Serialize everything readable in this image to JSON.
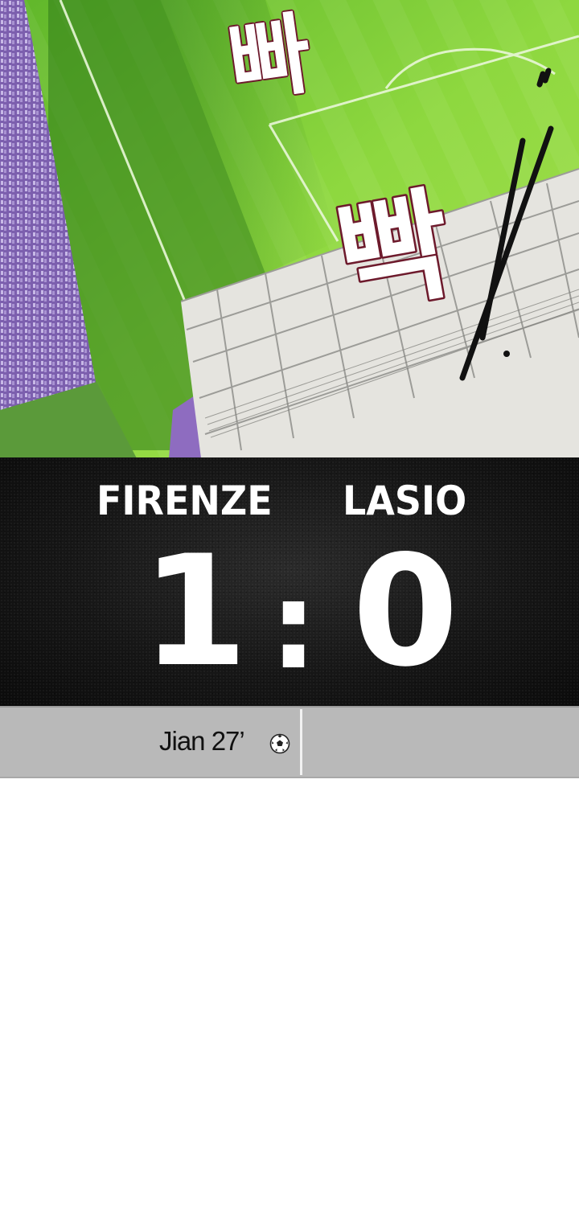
{
  "sound_effects": [
    "빠",
    "빡",
    "빠",
    "빡!"
  ],
  "scoreboard": {
    "home_team": "FIRENZE",
    "away_team": "LASIO",
    "home_score": "1",
    "separator": ":",
    "away_score": "0"
  },
  "scorers": {
    "home": "Jian 27’",
    "away": ""
  },
  "icons": {
    "goal": "soccer-ball-icon"
  },
  "colors": {
    "pitch": "#7fcf3a",
    "scoreboard_bg": "#141414",
    "scorer_bar": "#b9b9b9",
    "sfx_red": "#6d1a2c"
  }
}
